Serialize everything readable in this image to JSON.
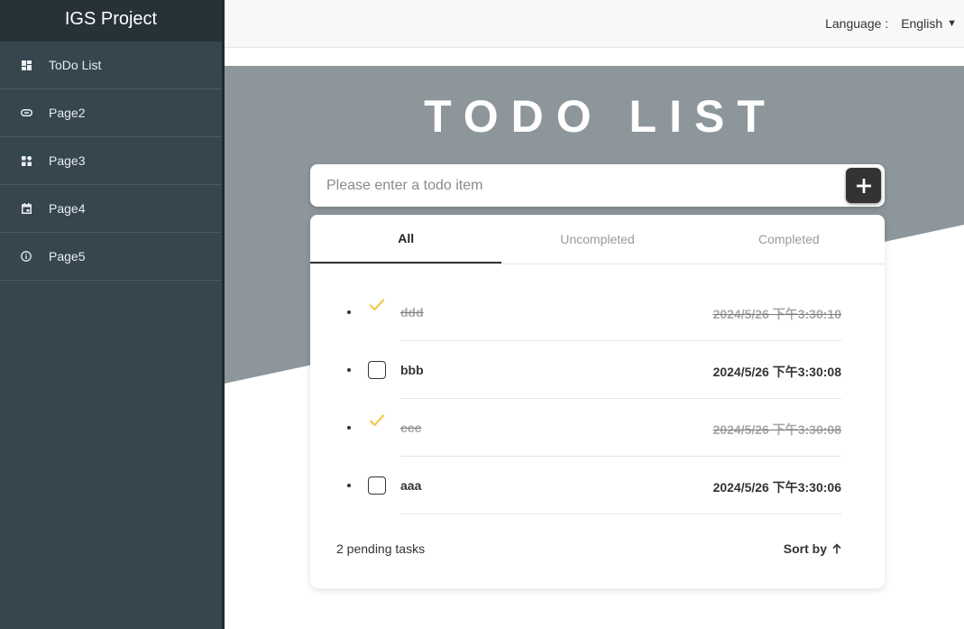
{
  "sidebar": {
    "brand": "IGS Project",
    "items": [
      {
        "label": "ToDo List",
        "icon": "dashboard-icon"
      },
      {
        "label": "Page2",
        "icon": "link-icon"
      },
      {
        "label": "Page3",
        "icon": "widgets-icon"
      },
      {
        "label": "Page4",
        "icon": "calendar-icon"
      },
      {
        "label": "Page5",
        "icon": "info-icon"
      }
    ]
  },
  "header": {
    "language_label": "Language :",
    "language_value": "English"
  },
  "main": {
    "title": "TODO LIST",
    "input_placeholder": "Please enter a todo item",
    "tabs": [
      {
        "label": "All",
        "active": true
      },
      {
        "label": "Uncompleted",
        "active": false
      },
      {
        "label": "Completed",
        "active": false
      }
    ],
    "todos": [
      {
        "text": "ddd",
        "time": "2024/5/26 下午3:30:10",
        "completed": true
      },
      {
        "text": "bbb",
        "time": "2024/5/26 下午3:30:08",
        "completed": false
      },
      {
        "text": "ccc",
        "time": "2024/5/26 下午3:30:08",
        "completed": true
      },
      {
        "text": "aaa",
        "time": "2024/5/26 下午3:30:06",
        "completed": false
      }
    ],
    "pending_text": "2 pending tasks",
    "sort_label": "Sort by"
  },
  "colors": {
    "sidebar_bg": "#36464f",
    "brand_bg": "#263238",
    "hero_bg": "#8d969b",
    "check_accent": "#f2c94c",
    "button_bg": "#333333"
  }
}
